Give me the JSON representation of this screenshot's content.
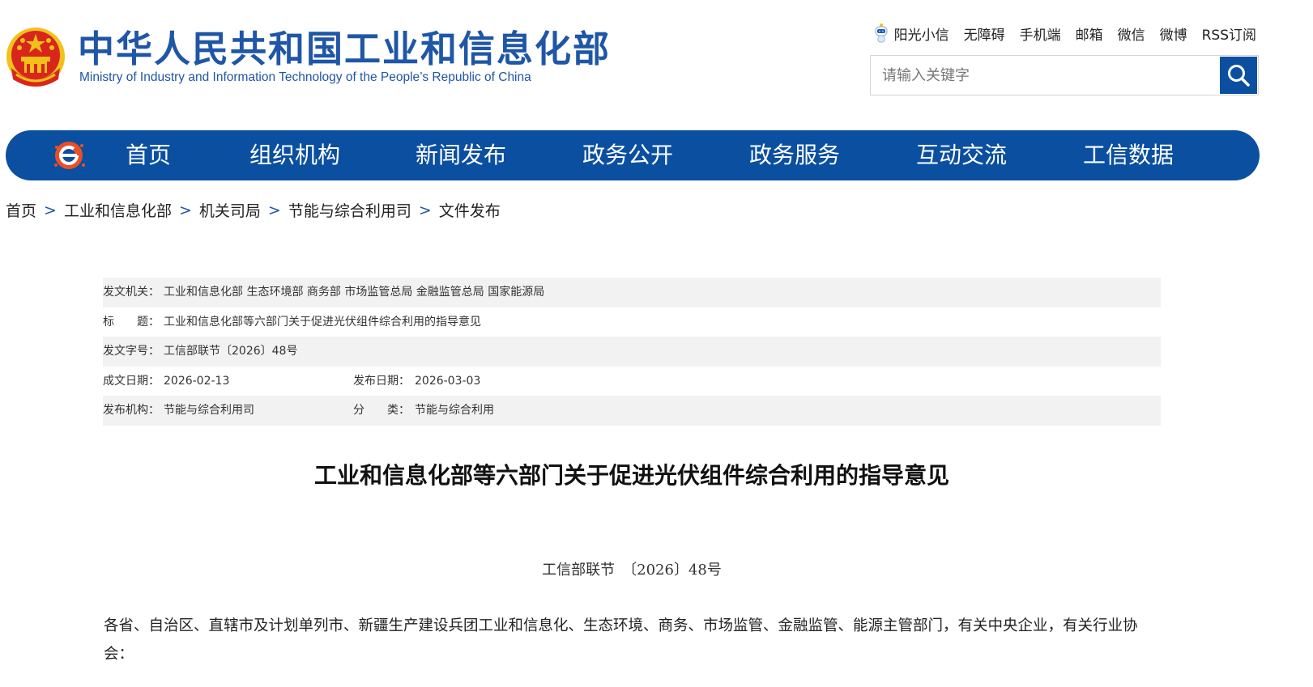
{
  "header": {
    "logo_cn": "中华人民共和国工业和信息化部",
    "logo_en": "Ministry of Industry and Information Technology of the People’s Republic of China",
    "top_links": [
      "阳光小信",
      "无障碍",
      "手机端",
      "邮箱",
      "微信",
      "微博",
      "RSS订阅"
    ],
    "search_placeholder": "请输入关键字"
  },
  "nav": {
    "items": [
      "首页",
      "组织机构",
      "新闻发布",
      "政务公开",
      "政务服务",
      "互动交流",
      "工信数据"
    ]
  },
  "breadcrumb": [
    "首页",
    "工业和信息化部",
    "机关司局",
    "节能与综合利用司",
    "文件发布"
  ],
  "breadcrumb_sep": ">",
  "info": {
    "issuer_label": "发文机关：",
    "issuer_value": "工业和信息化部 生态环境部 商务部 市场监管总局 金融监管总局 国家能源局",
    "title_label": "标　　题：",
    "title_value": "工业和信息化部等六部门关于促进光伏组件综合利用的指导意见",
    "docno_label": "发文字号：",
    "docno_value": "工信部联节〔2026〕48号",
    "written_label": "成文日期：",
    "written_value": "2026-02-13",
    "published_label": "发布日期：",
    "published_value": "2026-03-03",
    "org_label": "发布机构：",
    "org_value": "节能与综合利用司",
    "category_label": "分　　类：",
    "category_value": "节能与综合利用"
  },
  "article": {
    "title": "工业和信息化部等六部门关于促进光伏组件综合利用的指导意见",
    "doc_number": "工信部联节　〔2026〕48号",
    "salutation": "各省、自治区、直辖市及计划单列市、新疆生产建设兵团工业和信息化、生态环境、商务、市场监管、金融监管、能源主管部门，有关中央企业，有关行业协会："
  },
  "colors": {
    "brand_blue": "#0b4fa0",
    "logo_blue": "#1f56a6",
    "emblem_red": "#d9261c",
    "emblem_gold": "#f2c21b",
    "row_shade": "#f2f2f2"
  }
}
